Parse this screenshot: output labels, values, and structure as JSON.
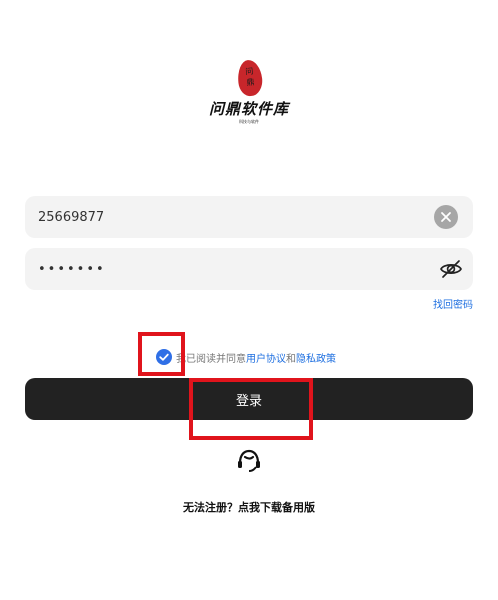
{
  "logo": {
    "seal_char_1": "问",
    "seal_char_2": "鼎",
    "title": "问鼎软件库",
    "subtitle": "科技与软件",
    "seal_color": "#c8262b"
  },
  "login_form": {
    "username": {
      "value": "25669877"
    },
    "password": {
      "value": "•••••••"
    },
    "forgot_password": "找回密码",
    "agreement": {
      "prefix": "我已阅读并同意",
      "user_agreement": "用户协议",
      "conjunction": "和",
      "privacy_policy": "隐私政策",
      "checked": true
    },
    "login_button": "登录"
  },
  "support": {
    "icon": "headset-support-icon"
  },
  "bottom_link": "无法注册？点我下载备用版",
  "colors": {
    "accent": "#1e6fe0",
    "checkbox": "#2f6fe6",
    "button": "#222222",
    "highlight": "#e0141c"
  }
}
